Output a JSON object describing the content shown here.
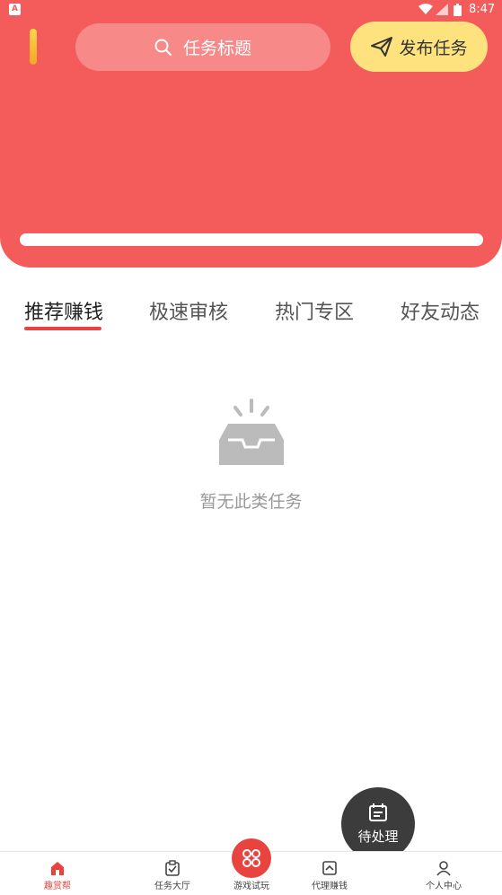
{
  "status_bar": {
    "time": "8:47"
  },
  "header": {
    "search_placeholder": "任务标题",
    "publish_label": "发布任务"
  },
  "tabs": [
    {
      "label": "推荐赚钱",
      "active": true
    },
    {
      "label": "极速审核",
      "active": false
    },
    {
      "label": "热门专区",
      "active": false
    },
    {
      "label": "好友动态",
      "active": false
    }
  ],
  "empty_state": {
    "text": "暂无此类任务",
    "icon": "empty-inbox-icon"
  },
  "fab": {
    "label": "待处理",
    "icon": "calendar-icon"
  },
  "bottom_nav": [
    {
      "label": "趣赏帮",
      "icon": "home-icon",
      "active": true
    },
    {
      "label": "任务大厅",
      "icon": "task-clipboard-icon",
      "active": false
    },
    {
      "label": "游戏试玩",
      "icon": "game-icon",
      "active": false
    },
    {
      "label": "代理赚钱",
      "icon": "agent-money-icon",
      "active": false
    },
    {
      "label": "个人中心",
      "icon": "user-icon",
      "active": false
    }
  ],
  "colors": {
    "header_bg": "#f45c5c",
    "accent": "#e8433e",
    "publish_bg": "#fde27e",
    "fab_bg": "#3c3c3c"
  }
}
